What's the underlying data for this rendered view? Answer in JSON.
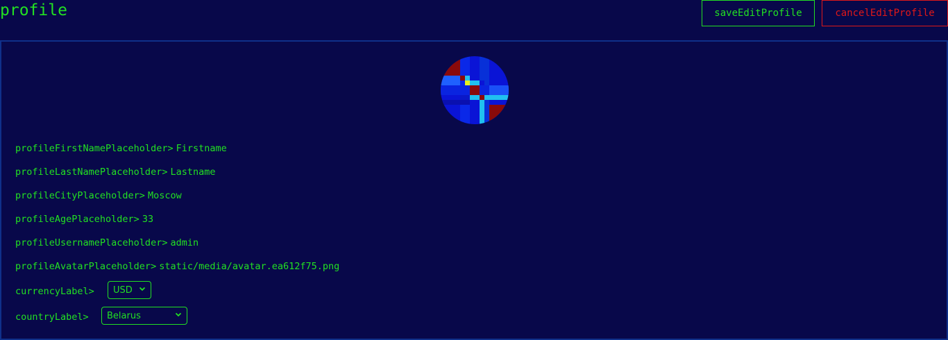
{
  "header": {
    "title": "profile",
    "save_label": "saveEditProfile",
    "cancel_label": "cancelEditProfile"
  },
  "profile": {
    "fields": [
      {
        "label": "profileFirstNamePlaceholder>",
        "value": "Firstname"
      },
      {
        "label": "profileLastNamePlaceholder>",
        "value": "Lastname"
      },
      {
        "label": "profileCityPlaceholder>",
        "value": "Moscow"
      },
      {
        "label": "profileAgePlaceholder>",
        "value": "33"
      },
      {
        "label": "profileUsernamePlaceholder>",
        "value": "admin"
      },
      {
        "label": "profileAvatarPlaceholder>",
        "value": "static/media/avatar.ea612f75.png"
      }
    ],
    "currency": {
      "label": "currencyLabel>",
      "selected": "USD"
    },
    "country": {
      "label": "countryLabel>",
      "selected": "Belarus"
    }
  },
  "colors": {
    "background": "#08084a",
    "text_green": "#22e022",
    "cancel_red": "#e01818",
    "card_border": "#10308a"
  },
  "icons": [
    "avatar-image",
    "chevron-down-icon"
  ]
}
